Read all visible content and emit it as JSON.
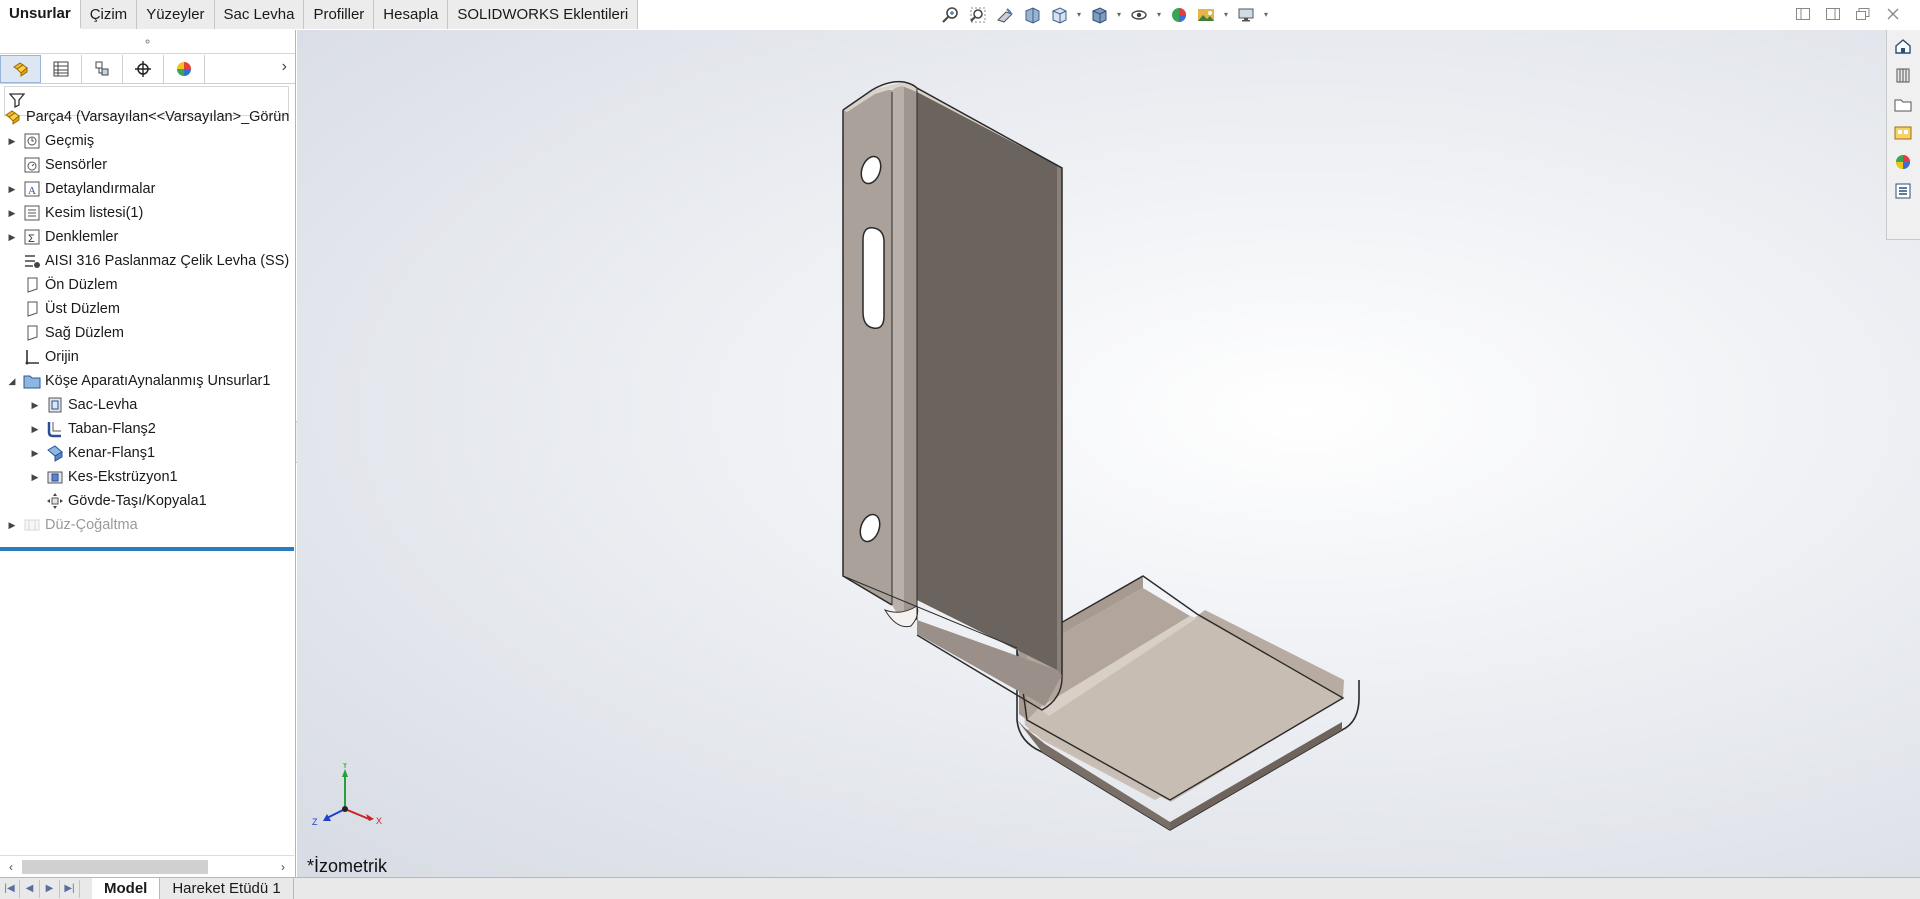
{
  "command_tabs": [
    {
      "label": "Unsurlar",
      "active": true
    },
    {
      "label": "Çizim"
    },
    {
      "label": "Yüzeyler"
    },
    {
      "label": "Sac Levha"
    },
    {
      "label": "Profiller"
    },
    {
      "label": "Hesapla"
    },
    {
      "label": "SOLIDWORKS Eklentileri"
    }
  ],
  "heads_up_toolbar": [
    "zoom-to-fit-icon",
    "zoom-to-area-icon",
    "previous-view-icon",
    "section-view-icon",
    "view-orientation-icon",
    "display-style-icon",
    "hide-show-items-icon",
    "edit-appearance-icon",
    "apply-scene-icon",
    "view-settings-icon"
  ],
  "window_buttons": [
    "tile-left-icon",
    "tile-right-icon",
    "restore-icon",
    "close-icon"
  ],
  "manager_tabs": [
    "featuremanager-icon",
    "propertymanager-icon",
    "configurationmanager-icon",
    "dimxpert-icon",
    "displaymanager-icon"
  ],
  "tree": {
    "root": "Parça4  (Varsayılan<<Varsayılan>_Görün",
    "items": [
      {
        "label": "Geçmiş",
        "icon": "history-icon",
        "expand": true,
        "level": 0
      },
      {
        "label": "Sensörler",
        "icon": "sensors-icon",
        "expand": false,
        "level": 0
      },
      {
        "label": "Detaylandırmalar",
        "icon": "annotations-icon",
        "expand": true,
        "level": 0
      },
      {
        "label": "Kesim listesi(1)",
        "icon": "cut-list-icon",
        "expand": true,
        "level": 0
      },
      {
        "label": "Denklemler",
        "icon": "equations-icon",
        "expand": true,
        "level": 0
      },
      {
        "label": "AISI 316 Paslanmaz Çelik Levha (SS)",
        "icon": "material-icon",
        "expand": false,
        "level": 0
      },
      {
        "label": "Ön Düzlem",
        "icon": "plane-icon",
        "expand": false,
        "level": 0
      },
      {
        "label": "Üst Düzlem",
        "icon": "plane-icon",
        "expand": false,
        "level": 0
      },
      {
        "label": "Sağ Düzlem",
        "icon": "plane-icon",
        "expand": false,
        "level": 0
      },
      {
        "label": "Orijin",
        "icon": "origin-icon",
        "expand": false,
        "level": 0
      },
      {
        "label": "Köşe AparatıAynalanmış Unsurlar1",
        "icon": "folder-icon",
        "expand": "open",
        "level": 0
      },
      {
        "label": "Sac-Levha",
        "icon": "sheet-metal-icon",
        "expand": true,
        "level": 1
      },
      {
        "label": "Taban-Flanş2",
        "icon": "base-flange-icon",
        "expand": true,
        "level": 1
      },
      {
        "label": "Kenar-Flanş1",
        "icon": "edge-flange-icon",
        "expand": true,
        "level": 1
      },
      {
        "label": "Kes-Ekstrüzyon1",
        "icon": "cut-extrude-icon",
        "expand": true,
        "level": 1
      },
      {
        "label": "Gövde-Taşı/Kopyala1",
        "icon": "move-copy-body-icon",
        "expand": false,
        "level": 1
      },
      {
        "label": "Düz-Çoğaltma",
        "icon": "flat-pattern-icon",
        "expand": true,
        "level": 0,
        "suppressed": true
      }
    ]
  },
  "viewport": {
    "view_name": "*İzometrik"
  },
  "triad": {
    "x": "X",
    "y": "Y",
    "z": "Z"
  },
  "task_pane": [
    "solidworks-resources-icon",
    "design-library-icon",
    "file-explorer-icon",
    "view-palette-icon",
    "appearances-icon",
    "custom-properties-icon"
  ],
  "bottom_tabs": [
    {
      "label": "Model",
      "active": true
    },
    {
      "label": "Hareket Etüdü 1"
    }
  ]
}
